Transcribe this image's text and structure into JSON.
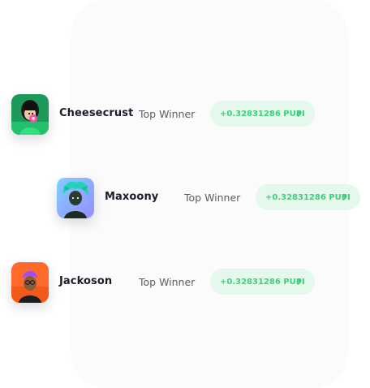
{
  "leaderboard": {
    "rows": [
      {
        "avatar_icon": "green-hooded-character-avatar",
        "name": "Cheesecrust",
        "label": "Top Winner",
        "amount": "+0.32831286 PUPI"
      },
      {
        "avatar_icon": "teal-haired-character-avatar",
        "name": "Maxoony",
        "label": "Top Winner",
        "amount": "+0.32831286 PUPI"
      },
      {
        "avatar_icon": "purple-haired-character-avatar",
        "name": "Jackoson",
        "label": "Top Winner",
        "amount": "+0.32831286 PUPI"
      }
    ],
    "colors": {
      "pill_bg": "#e4f8ec",
      "pill_text": "#3fcf7a",
      "name_text": "#1b1d28",
      "label_text": "#5b5e68"
    }
  }
}
